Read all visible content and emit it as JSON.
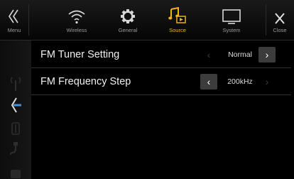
{
  "topbar": {
    "menu_label": "Menu",
    "close_label": "Close",
    "tabs": [
      {
        "label": "Wireless",
        "icon": "wifi-icon"
      },
      {
        "label": "General",
        "icon": "gear-icon"
      },
      {
        "label": "Source",
        "icon": "music-source-icon",
        "active": true
      },
      {
        "label": "System",
        "icon": "monitor-icon"
      }
    ]
  },
  "settings": [
    {
      "label": "FM Tuner Setting",
      "value": "Normal"
    },
    {
      "label": "FM Frequency Step",
      "value": "200kHz"
    }
  ],
  "colors": {
    "accent": "#f2b21c",
    "background": "#000000",
    "button": "#3c3c3c"
  }
}
